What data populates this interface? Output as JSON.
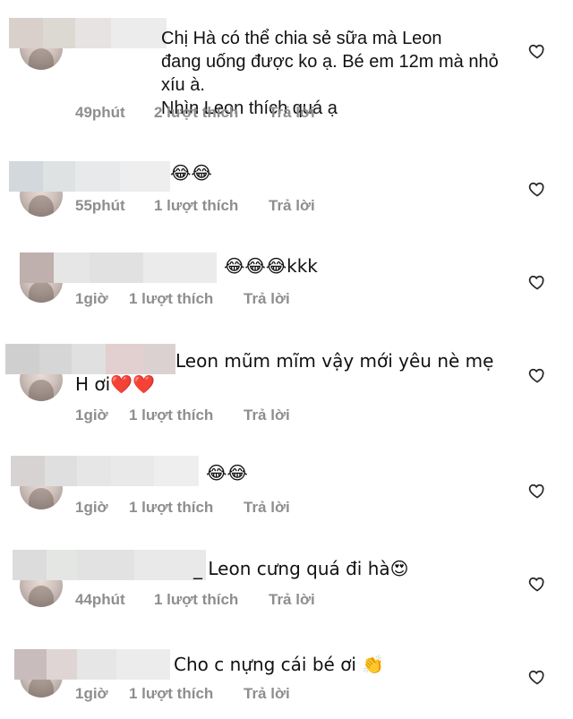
{
  "comments": [
    {
      "text": "Chị Hà có thể chia sẻ sữa mà Leon\nđang uống được ko ạ. Bé em 12m mà nhỏ xíu à.\nNhìn Leon thích quá ạ",
      "time": "49phút",
      "likes": "2 lượt thích",
      "reply": "Trả lời"
    },
    {
      "text": "😂😂",
      "time": "55phút",
      "likes": "1 lượt thích",
      "reply": "Trả lời"
    },
    {
      "text": "😂😂😂kkk",
      "time": "1giờ",
      "likes": "1 lượt thích",
      "reply": "Trả lời"
    },
    {
      "text": "Leon mũm mĩm vậy mới yêu nè mẹ\nH ơi❤️❤️",
      "time": "1giờ",
      "likes": "1 lượt thích",
      "reply": "Trả lời"
    },
    {
      "text": "😂😂",
      "time": "1giờ",
      "likes": "1 lượt thích",
      "reply": "Trả lời"
    },
    {
      "text": "_ Leon cưng quá đi hà😍",
      "time": "44phút",
      "likes": "1 lượt thích",
      "reply": "Trả lời"
    },
    {
      "text": "Cho c nựng cái bé ơi 👏",
      "time": "1giờ",
      "likes": "1 lượt thích",
      "reply": "Trả lời"
    }
  ],
  "icons": {
    "like": "heart-outline-icon"
  },
  "colors": {
    "meta": "#8e8e8e",
    "heart_stroke": "#262626"
  }
}
